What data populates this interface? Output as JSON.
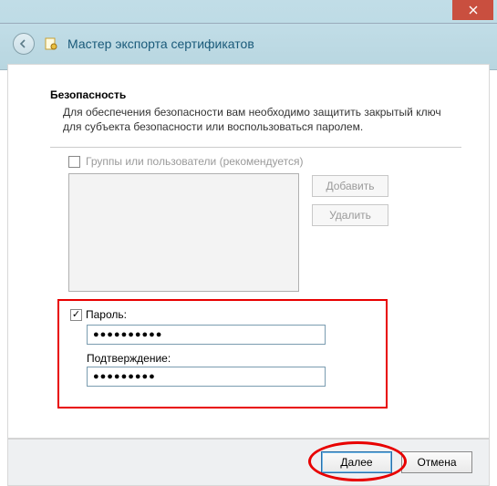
{
  "titlebar": {
    "close_tooltip": "Close"
  },
  "header": {
    "title": "Мастер экспорта сертификатов"
  },
  "section": {
    "title": "Безопасность",
    "description": "Для обеспечения безопасности вам необходимо защитить закрытый ключ для субъекта безопасности или воспользоваться паролем."
  },
  "groups": {
    "checkbox_label": "Группы или пользователи (рекомендуется)",
    "checked": false,
    "add_label": "Добавить",
    "remove_label": "Удалить"
  },
  "password": {
    "checkbox_label": "Пароль:",
    "checked": true,
    "value": "●●●●●●●●●●",
    "confirm_label": "Подтверждение:",
    "confirm_value": "●●●●●●●●●"
  },
  "footer": {
    "next_label": "Далее",
    "cancel_label": "Отмена"
  }
}
